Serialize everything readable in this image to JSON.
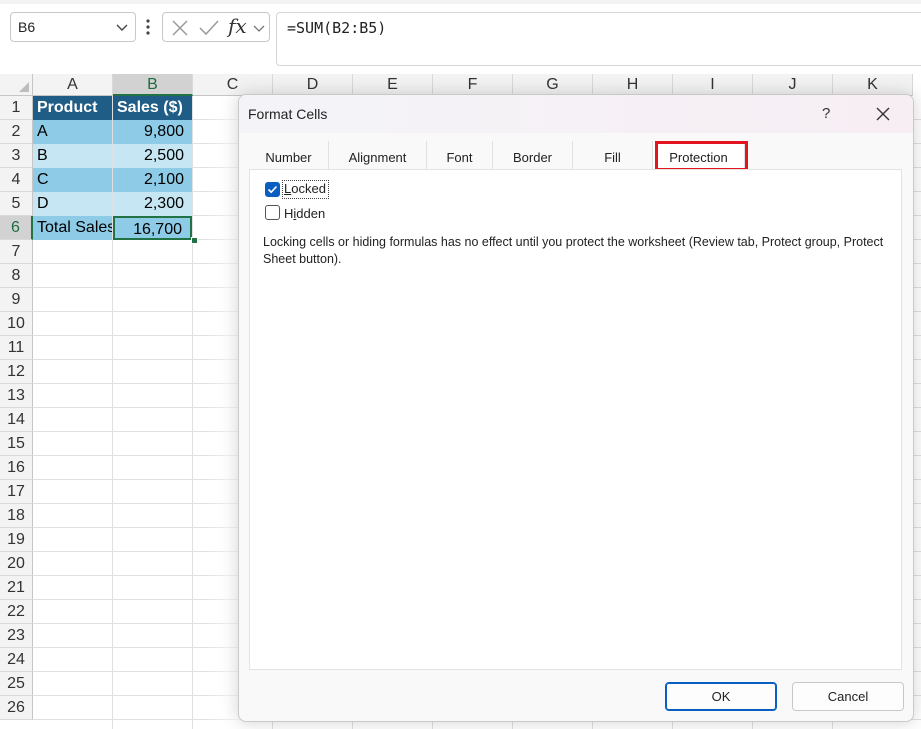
{
  "formula_bar": {
    "name_box": "B6",
    "formula": "=SUM(B2:B5)",
    "fx_label": "fx"
  },
  "columns": [
    "A",
    "B",
    "C",
    "D",
    "E",
    "F",
    "G",
    "H",
    "I",
    "J",
    "K"
  ],
  "rows": [
    "1",
    "2",
    "3",
    "4",
    "5",
    "6",
    "7",
    "8",
    "9",
    "10",
    "11",
    "12",
    "13",
    "14",
    "15",
    "16",
    "17",
    "18",
    "19",
    "20",
    "21",
    "22",
    "23",
    "24",
    "25",
    "26"
  ],
  "selected_cell": {
    "column": "B",
    "row": "6"
  },
  "table": {
    "headers": [
      "Product",
      "Sales ($)"
    ],
    "rows": [
      [
        "A",
        "9,800"
      ],
      [
        "B",
        "2,500"
      ],
      [
        "C",
        "2,100"
      ],
      [
        "D",
        "2,300"
      ],
      [
        "Total Sales",
        "16,700"
      ]
    ]
  },
  "colors": {
    "header_fill": "#1f5d86",
    "band_dark": "#8dcbe6",
    "band_light": "#c6e6f3",
    "selection": "#217346",
    "highlight_box": "#e3131f",
    "checkbox_on": "#0a5ec1"
  },
  "dialog": {
    "title": "Format Cells",
    "help": "?",
    "tabs": [
      "Number",
      "Alignment",
      "Font",
      "Border",
      "Fill",
      "Protection"
    ],
    "active_tab": "Protection",
    "locked": {
      "label_first": "L",
      "label_rest": "ocked",
      "checked": true
    },
    "hidden": {
      "label_first": "H",
      "label_mid": "i",
      "label_rest": "dden",
      "checked": false
    },
    "note": "Locking cells or hiding formulas has no effect until you protect the worksheet (Review tab, Protect group, Protect Sheet button).",
    "ok": "OK",
    "cancel": "Cancel"
  }
}
